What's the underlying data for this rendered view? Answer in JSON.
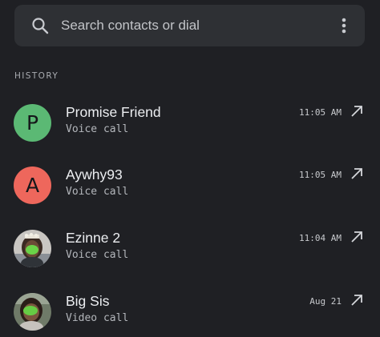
{
  "search": {
    "placeholder": "Search contacts or dial",
    "icon": "search-icon",
    "menu_icon": "more-vert-icon"
  },
  "history": {
    "header": "HISTORY",
    "calls": [
      {
        "name": "Promise Friend",
        "type": "Voice call",
        "time": "11:05 AM",
        "avatar_letter": "P",
        "avatar_color": "#5bb974",
        "direction_icon": "outgoing-call-icon"
      },
      {
        "name": "Aywhy93",
        "type": "Voice call",
        "time": "11:05 AM",
        "avatar_letter": "A",
        "avatar_color": "#ee675c",
        "direction_icon": "outgoing-call-icon"
      },
      {
        "name": "Ezinne 2",
        "type": "Voice call",
        "time": "11:04 AM",
        "avatar_letter": "",
        "avatar_color": "",
        "direction_icon": "outgoing-call-icon"
      },
      {
        "name": "Big Sis",
        "type": "Video call",
        "time": "Aug 21",
        "avatar_letter": "",
        "avatar_color": "",
        "direction_icon": "outgoing-call-icon"
      }
    ]
  },
  "colors": {
    "background": "#1f2024",
    "search_bar": "#2e3034",
    "primary_text": "#eceef1",
    "secondary_text": "#b4b7bc"
  }
}
